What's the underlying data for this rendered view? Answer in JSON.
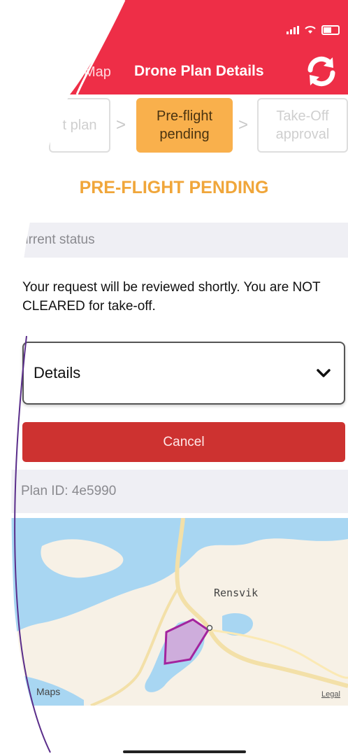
{
  "header": {
    "back_label": "Map",
    "title": "Drone Plan Details",
    "refresh_icon": "refresh-icon",
    "accent": "#ee2e47"
  },
  "steps": [
    {
      "label": "t plan",
      "state": "done"
    },
    {
      "label": "Pre-flight pending",
      "state": "active"
    },
    {
      "label": "Take-Off approval",
      "state": "upcoming"
    }
  ],
  "step_colors": {
    "active": "#f9b04c"
  },
  "heading": "PRE-FLIGHT PENDING",
  "status_section": {
    "label": "urrent status"
  },
  "message": "Your request will be reviewed shortly. You are NOT CLEARED for take-off.",
  "details": {
    "label": "Details",
    "icon": "chevron-down-icon"
  },
  "cancel": {
    "label": "Cancel",
    "color": "#cd3230"
  },
  "plan": {
    "id_label": "Plan ID: 4e5990"
  },
  "map": {
    "place_label": "Rensvik",
    "attribution": "Maps",
    "legal": "Legal"
  }
}
